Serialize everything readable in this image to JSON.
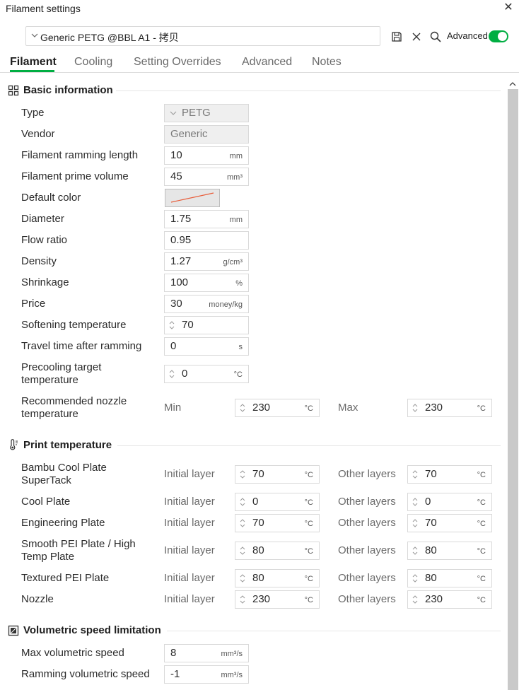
{
  "window": {
    "title": "Filament settings"
  },
  "toolbar": {
    "preset": "Generic PETG @BBL A1 - 拷贝",
    "advanced_label": "Advanced",
    "advanced_on": true,
    "accent": "#00ae42"
  },
  "tabs": [
    {
      "label": "Filament"
    },
    {
      "label": "Cooling"
    },
    {
      "label": "Setting Overrides"
    },
    {
      "label": "Advanced"
    },
    {
      "label": "Notes"
    }
  ],
  "sections": {
    "basic": "Basic information",
    "print_temp": "Print temperature",
    "volumetric": "Volumetric speed limitation"
  },
  "basic": {
    "type": {
      "label": "Type",
      "value": "PETG"
    },
    "vendor": {
      "label": "Vendor",
      "value": "Generic"
    },
    "ram_len": {
      "label": "Filament ramming length",
      "value": "10",
      "unit": "mm"
    },
    "prime_vol": {
      "label": "Filament prime volume",
      "value": "45",
      "unit": "mm³"
    },
    "color": {
      "label": "Default color",
      "swatch": "#e85d3a"
    },
    "diameter": {
      "label": "Diameter",
      "value": "1.75",
      "unit": "mm"
    },
    "flow": {
      "label": "Flow ratio",
      "value": "0.95"
    },
    "density": {
      "label": "Density",
      "value": "1.27",
      "unit": "g/cm³"
    },
    "shrink": {
      "label": "Shrinkage",
      "value": "100",
      "unit": "%"
    },
    "price": {
      "label": "Price",
      "value": "30",
      "unit": "money/kg"
    },
    "soften": {
      "label": "Softening temperature",
      "value": "70"
    },
    "travel": {
      "label": "Travel time after ramming",
      "value": "0",
      "unit": "s"
    },
    "precool": {
      "label1": "Precooling target",
      "label2": "temperature",
      "value": "0",
      "unit": "°C"
    },
    "nozzle_rec": {
      "label1": "Recommended nozzle",
      "label2": "temperature",
      "min_label": "Min",
      "min": "230",
      "max_label": "Max",
      "max": "230",
      "unit": "°C"
    }
  },
  "print_temp": {
    "initial_label": "Initial layer",
    "other_label": "Other layers",
    "unit": "°C",
    "rows": [
      {
        "label1": "Bambu Cool Plate",
        "label2": "SuperTack",
        "initial": "70",
        "other": "70"
      },
      {
        "label1": "Cool Plate",
        "label2": "",
        "initial": "0",
        "other": "0"
      },
      {
        "label1": "Engineering Plate",
        "label2": "",
        "initial": "70",
        "other": "70"
      },
      {
        "label1": "Smooth PEI Plate / High",
        "label2": "Temp Plate",
        "initial": "80",
        "other": "80"
      },
      {
        "label1": "Textured PEI Plate",
        "label2": "",
        "initial": "80",
        "other": "80"
      },
      {
        "label1": "Nozzle",
        "label2": "",
        "initial": "230",
        "other": "230"
      }
    ]
  },
  "volumetric": {
    "max": {
      "label": "Max volumetric speed",
      "value": "8",
      "unit": "mm³/s"
    },
    "ram": {
      "label": "Ramming volumetric speed",
      "value": "-1",
      "unit": "mm³/s"
    }
  }
}
